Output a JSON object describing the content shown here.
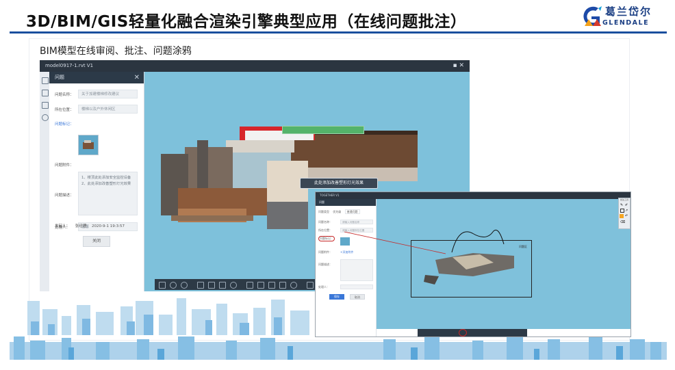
{
  "slide": {
    "title": "3D/BIM/GIS轻量化融合渲染引擎典型应用（在线问题批注）",
    "subtitle": "BIM模型在线审阅、批注、问题涂鸦"
  },
  "logo": {
    "cn": "葛兰岱尔",
    "en": "GLENDALE",
    "colors": {
      "blue": "#1d4aa8",
      "orange": "#f3a21b",
      "red": "#d73a2b",
      "cyan": "#16a0d8"
    }
  },
  "viewer_main": {
    "window_title": "model0917-1.rvt V1",
    "panel": {
      "title": "问题",
      "fields": [
        {
          "label": "问题名称：",
          "value": "关于加建楼梯修改建议"
        },
        {
          "label": "所在位置：",
          "value": "楼梯以及户外休闲区"
        },
        {
          "label": "问题标记：",
          "value": ""
        },
        {
          "label": "问题附件：",
          "value": ""
        },
        {
          "label": "问题描述：",
          "value": "1、楼顶此处添加安全监控设备\n2、此处添加改善塑形灯光效果"
        }
      ],
      "handler_label": "处理人：",
      "handler_value": "温馨",
      "creator_label": "发起人：",
      "creator_value": "张经理",
      "created_time": "2020-9-1 19:3:57",
      "close_button": "关闭"
    },
    "tooltip": "此处添加改善塑形灯光效果"
  },
  "viewer_annot": {
    "window_title": "TOGETHER V1",
    "panel": {
      "title": "问题",
      "row1_a": "问题类型",
      "row1_b": "优先级",
      "row1_c": "普通问题",
      "field1": {
        "label": "问题名称：",
        "placeholder": "请输入问题名称"
      },
      "field2": {
        "label": "所在位置：",
        "placeholder": "请输入问题所在位置"
      },
      "field3": {
        "label": "问题标记："
      },
      "field4": {
        "label": "问题附件：",
        "link": "+添加附件"
      },
      "field5": {
        "label": "问题描述："
      },
      "field6": {
        "label": "处理人："
      },
      "save": "保存",
      "cancel": "取消"
    },
    "tool_panel_title": "批注工具",
    "canvas_label": "问题区"
  }
}
